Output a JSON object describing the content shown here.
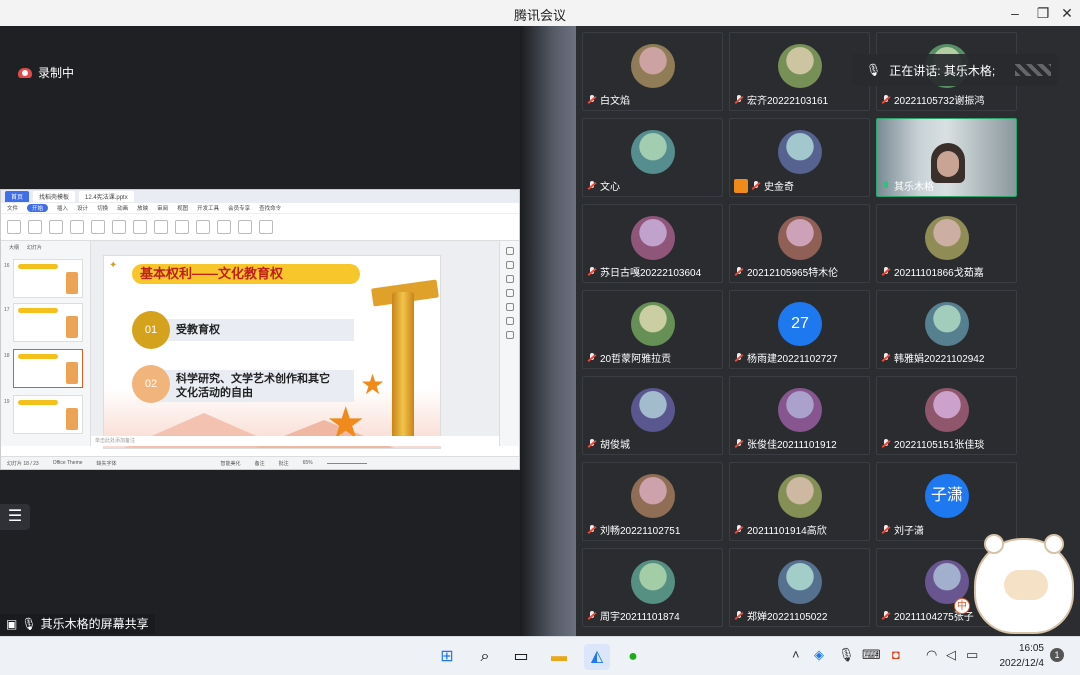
{
  "window": {
    "title": "腾讯会议"
  },
  "recording": {
    "label": "录制中"
  },
  "speaker_toast": {
    "label": "正在讲话: 其乐木格;"
  },
  "share": {
    "label": "其乐木格的屏幕共享"
  },
  "slide": {
    "heading": "基本权利——文化教育权",
    "items": [
      {
        "num": "01",
        "text": "受教育权"
      },
      {
        "num": "02",
        "line1": "科学研究、文学艺术创作和其它",
        "line2": "文化活动的自由"
      }
    ]
  },
  "wps": {
    "tabs": [
      "首页",
      "找稻壳模板",
      "12.4宪法课.pptx"
    ],
    "menu": [
      "文件",
      "开始",
      "插入",
      "设计",
      "切换",
      "动画",
      "放映",
      "审阅",
      "视图",
      "开发工具",
      "会员专享",
      "查找命令"
    ],
    "thumb_tabs": [
      "大纲",
      "幻灯片"
    ],
    "thumb_nums": [
      "16",
      "17",
      "18",
      "19"
    ],
    "notes": "单击此处添加备注",
    "status": [
      "幻灯片 18 / 23",
      "Office Theme",
      "缺失字体",
      "智能美化",
      "备注",
      "批注",
      "65%"
    ]
  },
  "participants": [
    {
      "name": "白文焰",
      "avatar": "photo"
    },
    {
      "name": "宏齐20222103161",
      "avatar": "photo"
    },
    {
      "name": "20221105732谢振鸿",
      "avatar": "photo"
    },
    {
      "name": "文心",
      "avatar": "photo"
    },
    {
      "name": "史金奇",
      "avatar": "photo",
      "cam": true
    },
    {
      "name": "其乐木格",
      "avatar": "video",
      "speaking": true
    },
    {
      "name": "苏日古嘎20222103604",
      "avatar": "photo"
    },
    {
      "name": "20212105965特木伦",
      "avatar": "photo"
    },
    {
      "name": "20211101866戈茹嘉",
      "avatar": "photo"
    },
    {
      "name": "20哲蒙阿雅拉贡",
      "avatar": "photo"
    },
    {
      "name": "杨雨建20221102727",
      "avatar": "27"
    },
    {
      "name": "韩雅娟20221102942",
      "avatar": "photo"
    },
    {
      "name": "胡俊城",
      "avatar": "photo"
    },
    {
      "name": "张俊佳20211101912",
      "avatar": "photo"
    },
    {
      "name": "20221105151张佳琰",
      "avatar": "photo"
    },
    {
      "name": "刘畅20221102751",
      "avatar": "photo"
    },
    {
      "name": "20211101914高欣",
      "avatar": "photo"
    },
    {
      "name": "刘子潇",
      "avatar": "子潇"
    },
    {
      "name": "周宇20211101874",
      "avatar": "photo"
    },
    {
      "name": "郑婵20221105022",
      "avatar": "photo"
    },
    {
      "name": "20211104275张子",
      "avatar": "photo"
    }
  ],
  "sticker": {
    "badge": "中"
  },
  "taskbar": {
    "time": "16:05",
    "date": "2022/12/4",
    "notifications": "1"
  },
  "colors": {
    "accent": "#1e78f0",
    "speaking": "#2aa56b",
    "muted": "#e5493a"
  }
}
